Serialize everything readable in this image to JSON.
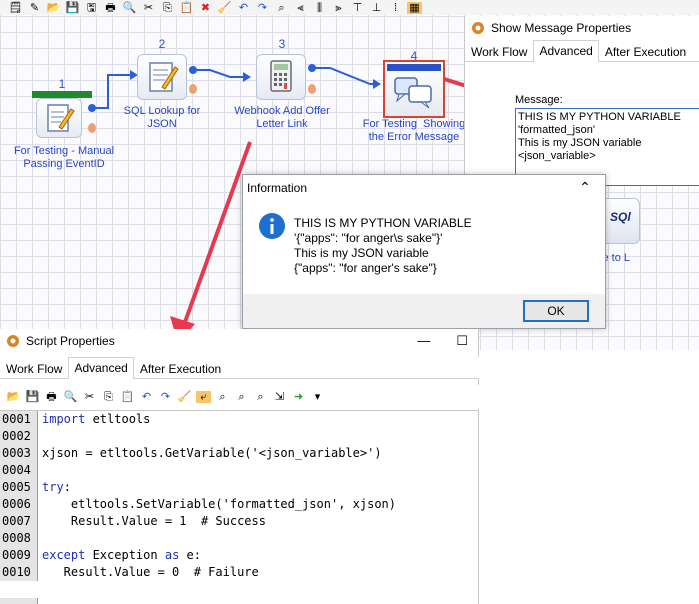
{
  "canvas": {
    "nodes": [
      {
        "number": "1",
        "label": "For Testing - Manual\nPassing EventID"
      },
      {
        "number": "2",
        "label": "SQL Lookup for\nJSON"
      },
      {
        "number": "3",
        "label": "Webhook Add Offer\nLetter Link"
      },
      {
        "number": "4",
        "label": "For Testing  Showing\nthe Error Message"
      }
    ],
    "partial_node": {
      "icon_text": "SQl",
      "label": "ite to L"
    }
  },
  "message_window": {
    "title": "Show Message Properties",
    "tabs": [
      "Work Flow",
      "Advanced",
      "After Execution"
    ],
    "active_tab": "Advanced",
    "message_label": "Message:",
    "message_value": "THIS IS MY PYTHON VARIABLE\n'formatted_json'\nThis is my JSON variable\n<json_variable>"
  },
  "info_dialog": {
    "title": "Information",
    "close_glyph": "⌃",
    "lines": [
      "THIS IS MY PYTHON VARIABLE",
      "'{\"apps\": \"for anger\\s sake\"}'",
      "This is my JSON variable",
      "{\"apps\": \"for anger's sake\"}"
    ],
    "ok_label": "OK"
  },
  "script_window": {
    "title": "Script Properties",
    "minimize_glyph": "—",
    "maximize_glyph": "☐",
    "tabs": [
      "Work Flow",
      "Advanced",
      "After Execution"
    ],
    "active_tab": "Advanced",
    "code": [
      {
        "ln": "0001",
        "text": "import etltools",
        "kw": "import"
      },
      {
        "ln": "0002",
        "text": "",
        "kw": ""
      },
      {
        "ln": "0003",
        "text": "xjson = etltools.GetVariable('<json_variable>')",
        "kw": ""
      },
      {
        "ln": "0004",
        "text": "",
        "kw": ""
      },
      {
        "ln": "0005",
        "text": "try:",
        "kw": "try"
      },
      {
        "ln": "0006",
        "text": "    etltools.SetVariable('formatted_json', xjson)",
        "kw": ""
      },
      {
        "ln": "0007",
        "text": "    Result.Value = 1  # Success",
        "kw": ""
      },
      {
        "ln": "0008",
        "text": "",
        "kw": ""
      },
      {
        "ln": "0009",
        "text": "except Exception as e:",
        "kw": "except"
      },
      {
        "ln": "0010",
        "text": "   Result.Value = 0  # Failure",
        "kw": ""
      }
    ]
  },
  "colors": {
    "link_blue": "#2645c8",
    "port_blue": "#2a5fd8",
    "arrow_red": "#e8384f",
    "keyword_blue": "#1d2fb8",
    "ok_border": "#1f6fd0"
  }
}
